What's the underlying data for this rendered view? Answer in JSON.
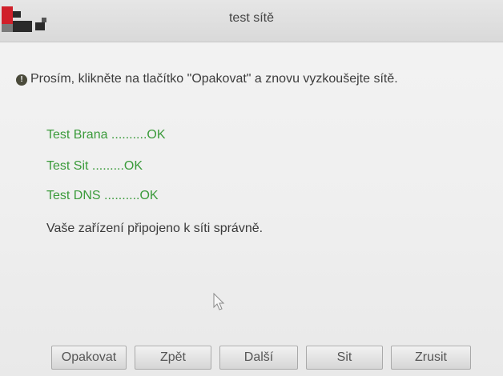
{
  "window": {
    "title": "test sítě"
  },
  "hint": {
    "icon": "info-icon",
    "text": "Prosím, klikněte na tlačítko \"Opakovat\" a znovu vyzkoušejte sítě."
  },
  "results": [
    {
      "text": "Test Brana ..........OK"
    },
    {
      "text": "Test Sit .........OK"
    },
    {
      "text": "Test DNS ..........OK"
    }
  ],
  "status": "Vaše zařízení připojeno k síti správně.",
  "buttons": {
    "retry": "Opakovat",
    "back": "Zpět",
    "next": "Další",
    "network": "Sit",
    "cancel": "Zrusit"
  },
  "colors": {
    "ok_text": "#3a9a3a",
    "logo_red": "#d0202a",
    "logo_dark": "#2a2a2a"
  }
}
